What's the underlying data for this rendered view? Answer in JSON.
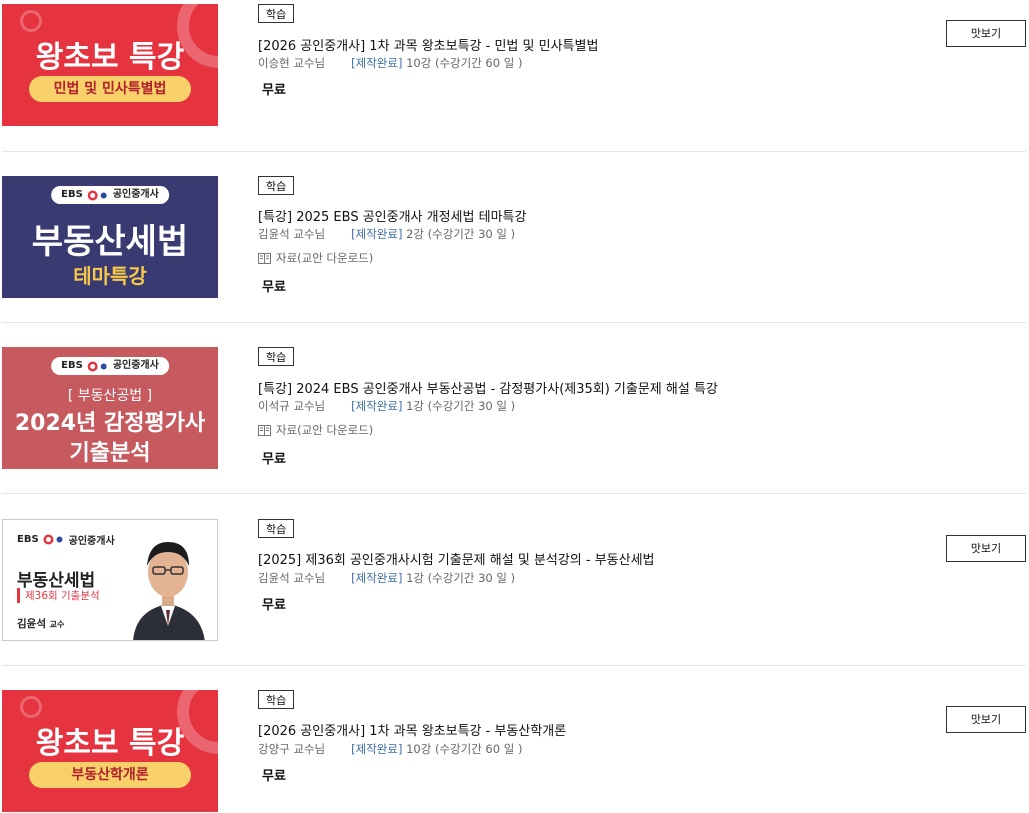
{
  "courses": [
    {
      "tag": "학습",
      "title": "[2026 공인중개사] 1차 과목 왕초보특강 - 민법 및 민사특별법",
      "instructor": "이승현 교수님",
      "status": "[제작완료]",
      "lessons": "10강 (수강기간 60 일 )",
      "price": "무료",
      "preview": "맛보기",
      "thumb": {
        "line1": "왕초보 특강",
        "line2": "민법 및 민사특별법"
      }
    },
    {
      "tag": "학습",
      "title": "[특강] 2025 EBS 공인중개사 개정세법 테마특강",
      "instructor": "김윤석 교수님",
      "status": "[제작완료]",
      "lessons": "2강 (수강기간 30 일 )",
      "resource": "자료(교안 다운로드)",
      "price": "무료",
      "thumb": {
        "brand": "EBS",
        "brand_sub": "공인중개사",
        "line1": "부동산세법",
        "line2": "테마특강"
      }
    },
    {
      "tag": "학습",
      "title": "[특강] 2024 EBS 공인중개사 부동산공법 - 감정평가사(제35회) 기출문제 해설 특강",
      "instructor": "이석규 교수님",
      "status": "[제작완료]",
      "lessons": "1강 (수강기간 30 일 )",
      "resource": "자료(교안 다운로드)",
      "price": "무료",
      "thumb": {
        "brand": "EBS",
        "brand_sub": "공인중개사",
        "line0": "[ 부동산공법 ]",
        "line1": "2024년 감정평가사",
        "line2": "기출분석"
      }
    },
    {
      "tag": "학습",
      "title": "[2025] 제36회 공인중개사시험 기출문제 해설 및 분석강의 - 부동산세법",
      "instructor": "김윤석 교수님",
      "status": "[제작완료]",
      "lessons": "1강 (수강기간 30 일 )",
      "price": "무료",
      "preview": "맛보기",
      "thumb": {
        "brand": "EBS",
        "brand_sub": "공인중개사",
        "line1": "부동산세법",
        "line2": "제36회 기출분석",
        "name": "김윤석",
        "name_suffix": "교수"
      }
    },
    {
      "tag": "학습",
      "title": "[2026 공인중개사] 1차 과목 왕초보특강 - 부동산학개론",
      "instructor": "강양구 교수님",
      "status": "[제작완료]",
      "lessons": "10강 (수강기간 60 일 )",
      "price": "무료",
      "preview": "맛보기",
      "thumb": {
        "line1": "왕초보 특강",
        "line2": "부동산학개론"
      }
    }
  ]
}
